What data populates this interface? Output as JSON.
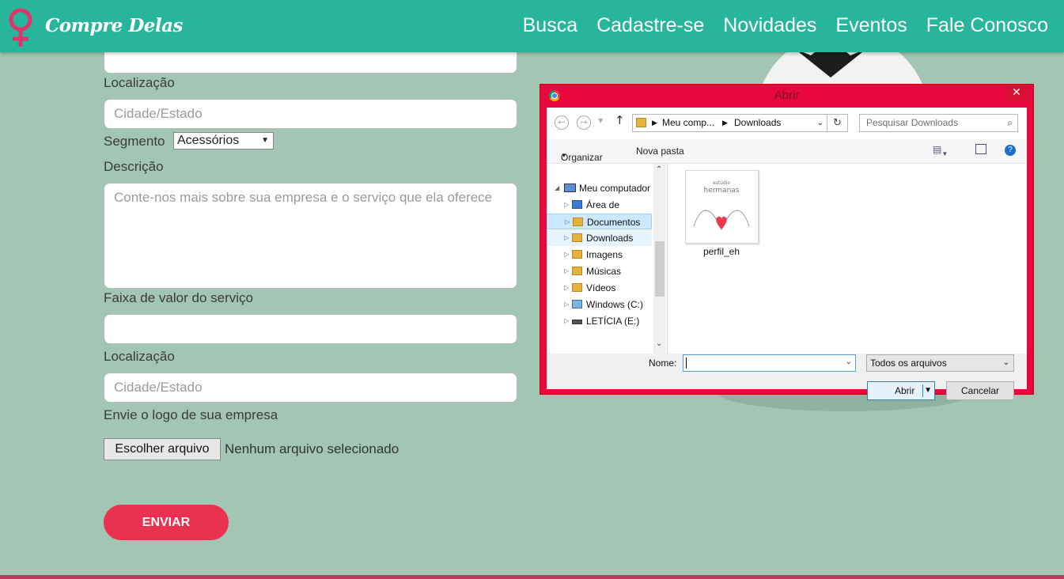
{
  "header": {
    "brand": "Compre Delas",
    "nav": [
      "Busca",
      "Cadastre-se",
      "Novidades",
      "Eventos",
      "Fale Conosco"
    ]
  },
  "form": {
    "location_label_1": "Localização",
    "location_placeholder_1": "Cidade/Estado",
    "segment_label": "Segmento",
    "segment_value": "Acessórios",
    "description_label": "Descrição",
    "description_placeholder": "Conte-nos mais sobre sua empresa e o serviço que ela oferece",
    "price_label": "Faixa de valor do serviço",
    "location_label_2": "Localização",
    "location_placeholder_2": "Cidade/Estado",
    "logo_label": "Envie o logo de sua empresa",
    "file_button": "Escolher arquivo",
    "file_status": "Nenhum arquivo selecionado",
    "submit": "ENVIAR"
  },
  "dialog": {
    "title": "Abrir",
    "close": "✕",
    "path": [
      "Meu comp...",
      "Downloads"
    ],
    "search_placeholder": "Pesquisar Downloads",
    "organize": "Organizar",
    "new_folder": "Nova pasta",
    "tree": [
      {
        "label": "Meu computador",
        "state": "normal"
      },
      {
        "label": "Área de Trabalh",
        "state": "normal"
      },
      {
        "label": "Documentos",
        "state": "selected"
      },
      {
        "label": "Downloads",
        "state": "hover"
      },
      {
        "label": "Imagens",
        "state": "normal"
      },
      {
        "label": "Músicas",
        "state": "normal"
      },
      {
        "label": "Vídeos",
        "state": "normal"
      },
      {
        "label": "Windows (C:)",
        "state": "normal"
      },
      {
        "label": "LETÍCIA (E:)",
        "state": "normal"
      }
    ],
    "file": {
      "name": "perfil_eh",
      "thumb_text_small": "estúdio",
      "thumb_text": "hermanas"
    },
    "name_label": "Nome:",
    "name_value": "",
    "file_type": "Todos os arquivos",
    "open_button": "Abrir",
    "cancel_button": "Cancelar"
  },
  "colors": {
    "header": "#27b59b",
    "background": "#a3c6b4",
    "accent": "#ea3150",
    "dialog_frame": "#e8083f"
  }
}
